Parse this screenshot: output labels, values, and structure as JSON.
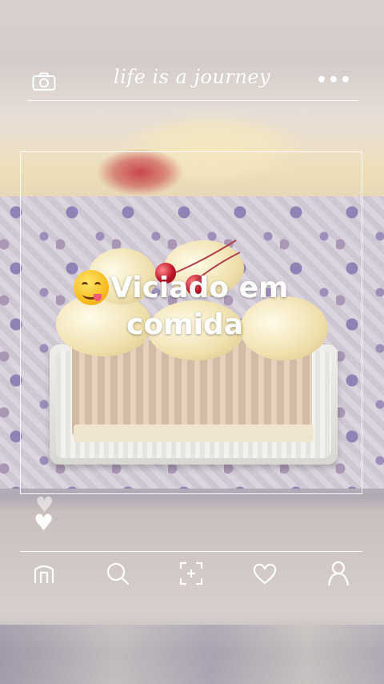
{
  "header": {
    "title": "life is a journey",
    "camera_icon": "camera-icon",
    "more_icon": "more-dots-icon",
    "more_label": "•••"
  },
  "post": {
    "caption_line1": "Viciado em",
    "caption_line2": "comida",
    "emoji": "face-savoring-food-emoji"
  },
  "actions": {
    "like_icon": "heart-icon",
    "like_glyph": "♥"
  },
  "bottom_nav": {
    "items": [
      {
        "icon": "home-icon"
      },
      {
        "icon": "search-icon"
      },
      {
        "icon": "add-post-icon"
      },
      {
        "icon": "heart-outline-icon"
      },
      {
        "icon": "profile-icon"
      }
    ]
  },
  "colors": {
    "overlay_lines": "#ffffff",
    "cherry": "#c0142a",
    "cream": "#efe0ad"
  }
}
